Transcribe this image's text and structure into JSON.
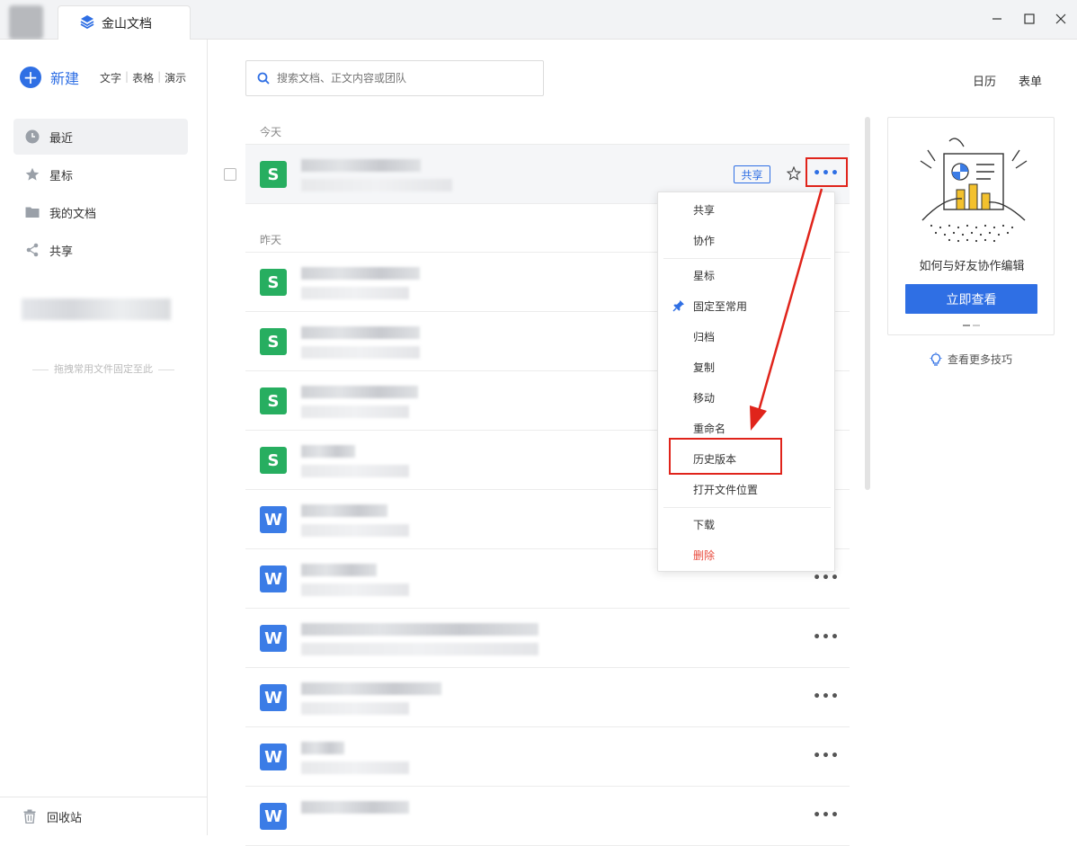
{
  "tab": {
    "title": "金山文档"
  },
  "sidebar": {
    "new_label": "新建",
    "quick": [
      "文字",
      "表格",
      "演示"
    ],
    "items": [
      {
        "label": "最近",
        "icon": "clock-icon"
      },
      {
        "label": "星标",
        "icon": "star-icon"
      },
      {
        "label": "我的文档",
        "icon": "folder-icon"
      },
      {
        "label": "共享",
        "icon": "share-icon"
      }
    ],
    "pin_hint": "拖拽常用文件固定至此",
    "trash_label": "回收站"
  },
  "search": {
    "placeholder": "搜索文档、正文内容或团队"
  },
  "top_links": {
    "calendar": "日历",
    "form": "表单"
  },
  "groups": {
    "today": "今天",
    "yesterday": "昨天"
  },
  "files": [
    {
      "type": "S",
      "share_tag": "共享"
    },
    {
      "type": "S"
    },
    {
      "type": "S"
    },
    {
      "type": "S"
    },
    {
      "type": "S"
    },
    {
      "type": "W"
    },
    {
      "type": "W"
    },
    {
      "type": "W"
    },
    {
      "type": "W"
    },
    {
      "type": "W"
    },
    {
      "type": "W"
    }
  ],
  "context_menu": {
    "items": [
      "共享",
      "协作",
      "星标",
      "固定至常用",
      "归档",
      "复制",
      "移动",
      "重命名",
      "历史版本",
      "打开文件位置",
      "下载",
      "删除"
    ]
  },
  "promo": {
    "title": "如何与好友协作编辑",
    "button": "立即查看"
  },
  "tips": {
    "label": "查看更多技巧"
  },
  "colors": {
    "accent": "#2f6fe4",
    "sheet": "#27ae60",
    "word": "#3b7ce6",
    "highlight": "#e0241b",
    "danger": "#e84a3c"
  }
}
